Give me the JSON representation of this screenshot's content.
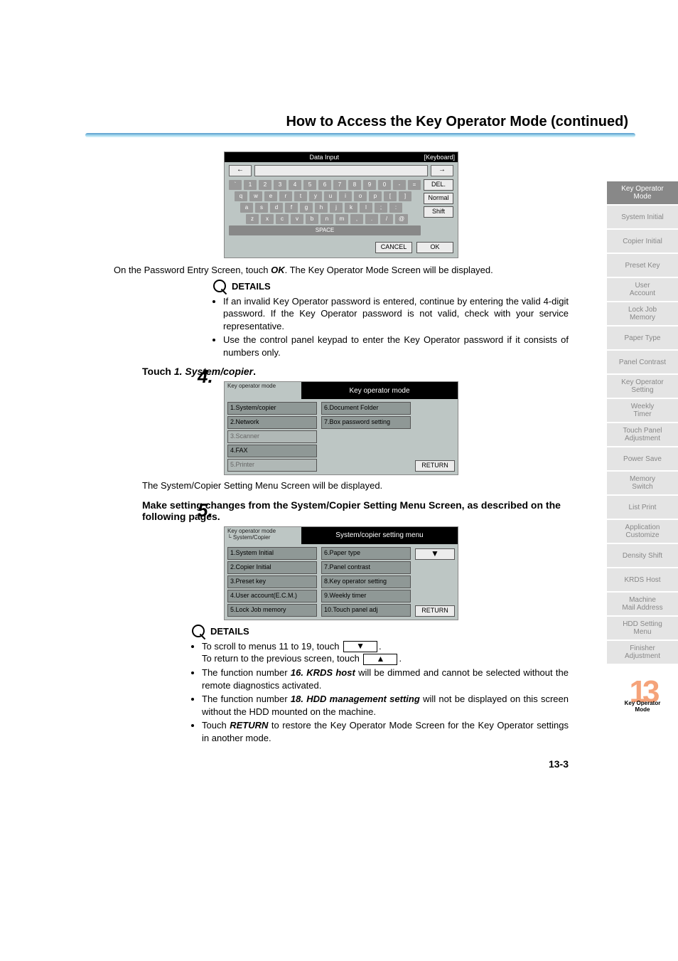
{
  "header": {
    "title": "How to Access the Key Operator Mode (continued)"
  },
  "keyboard": {
    "top_center": "Data Input",
    "top_right": "[Keyboard]",
    "arrow_left": "←",
    "arrow_right": "→",
    "row1": [
      "`",
      "1",
      "2",
      "3",
      "4",
      "5",
      "6",
      "7",
      "8",
      "9",
      "0",
      "-",
      "="
    ],
    "row2": [
      "q",
      "w",
      "e",
      "r",
      "t",
      "y",
      "u",
      "i",
      "o",
      "p",
      "[",
      "]"
    ],
    "row3": [
      "a",
      "s",
      "d",
      "f",
      "g",
      "h",
      "j",
      "k",
      "l",
      ";",
      ":"
    ],
    "row4": [
      "z",
      "x",
      "c",
      "v",
      "b",
      "n",
      "m",
      ",",
      ".",
      "/",
      "@"
    ],
    "space": "SPACE",
    "del": "DEL.",
    "normal": "Normal",
    "shift": "Shift",
    "cancel": "CANCEL",
    "ok": "OK"
  },
  "text": {
    "pw_entry": "On the Password Entry Screen, touch ",
    "pw_ok": "OK",
    "pw_after": ". The Key Operator Mode Screen will be displayed.",
    "details_title": "DETAILS",
    "d1_b1": "If an invalid Key Operator password is entered, continue by entering the valid 4-digit password. If the Key Operator password is not valid, check with your service representative.",
    "d1_b2": "Use the control panel keypad to enter the Key Operator password if it consists of numbers only.",
    "step4_num": "4.",
    "step4_text_a": "Touch ",
    "step4_text_b": "1. System/copier",
    "step4_text_c": ".",
    "after_menu1": "The System/Copier Setting Menu Screen will be displayed.",
    "step5_num": "5.",
    "step5_text": "Make setting changes from the System/Copier Setting Menu Screen, as described on the following pages.",
    "d2_b1_a": "To scroll to menus 11 to 19, touch ",
    "d2_b1_b": ".",
    "d2_b1_c": "To return to the previous screen, touch ",
    "d2_b1_d": ".",
    "d2_b2_a": "The function number ",
    "d2_b2_b": "16. KRDS host",
    "d2_b2_c": " will be dimmed and cannot be selected without the remote diagnostics activated.",
    "d2_b3_a": "The function number ",
    "d2_b3_b": "18. HDD management setting",
    "d2_b3_c": " will not be displayed on this screen without the HDD mounted on the machine.",
    "d2_b4_a": "Touch ",
    "d2_b4_b": "RETURN",
    "d2_b4_c": " to restore the Key Operator Mode Screen for the Key Operator settings in another mode.",
    "page_num": "13-3"
  },
  "menu1": {
    "crumb": "Key operator mode",
    "title": "Key operator mode",
    "col1": [
      "1.System/copier",
      "2.Network",
      "3.Scanner",
      "4.FAX",
      "5.Printer"
    ],
    "col2": [
      "6.Document Folder",
      "7.Box password setting"
    ],
    "return": "RETURN"
  },
  "menu2": {
    "crumb": "Key operator mode\n └ System/Copier",
    "title": "System/copier setting menu",
    "col1": [
      "1.System Initial",
      "2.Copier Initial",
      "3.Preset key",
      "4.User account(E.C.M.)",
      "5.Lock Job memory"
    ],
    "col2": [
      "6.Paper type",
      "7.Panel contrast",
      "8.Key operator setting",
      "9.Weekly timer",
      "10.Touch panel adj"
    ],
    "return": "RETURN",
    "down": "▼",
    "up": "▲"
  },
  "sidebar": {
    "items": [
      {
        "l1": "Key Operator",
        "l2": "Mode",
        "dark": true
      },
      {
        "l1": "System Initial",
        "l2": ""
      },
      {
        "l1": "Copier Initial",
        "l2": ""
      },
      {
        "l1": "Preset Key",
        "l2": ""
      },
      {
        "l1": "User",
        "l2": "Account"
      },
      {
        "l1": "Lock Job",
        "l2": "Memory"
      },
      {
        "l1": "Paper Type",
        "l2": ""
      },
      {
        "l1": "Panel Contrast",
        "l2": ""
      },
      {
        "l1": "Key Operator",
        "l2": "Setting"
      },
      {
        "l1": "Weekly",
        "l2": "Timer"
      },
      {
        "l1": "Touch Panel",
        "l2": "Adjustment"
      },
      {
        "l1": "Power Save",
        "l2": ""
      },
      {
        "l1": "Memory",
        "l2": "Switch"
      },
      {
        "l1": "List Print",
        "l2": ""
      },
      {
        "l1": "Application",
        "l2": "Customize"
      },
      {
        "l1": "Density Shift",
        "l2": ""
      },
      {
        "l1": "KRDS Host",
        "l2": ""
      },
      {
        "l1": "Machine",
        "l2": "Mail Address"
      },
      {
        "l1": "HDD Setting",
        "l2": "Menu"
      },
      {
        "l1": "Finisher",
        "l2": "Adjustment"
      }
    ],
    "chapter_big": "13",
    "chapter_label_1": "Key Operator",
    "chapter_label_2": "Mode"
  }
}
